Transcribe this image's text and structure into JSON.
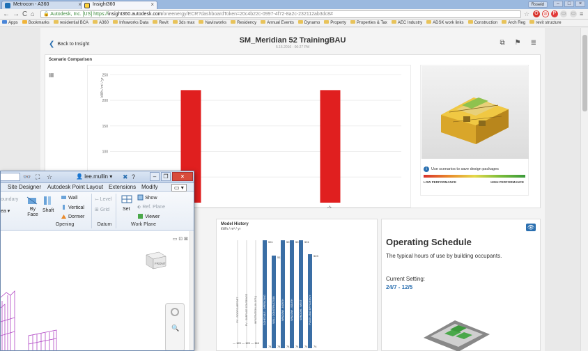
{
  "browser": {
    "tabs": [
      {
        "label": "Metrocon - A360",
        "icon": "a360-icon"
      },
      {
        "label": "Insight360",
        "icon": "insight-icon"
      }
    ],
    "user_chip": "Rsseid",
    "address": {
      "secure": "Autodesk, Inc. [US]",
      "scheme": "https://",
      "host": "insight360.autodesk.com",
      "path": "/oneenergy/ECR?dashboardToken=20c4b22c-0997-4f72-8a2c-232112ab3dc8#"
    },
    "bookmarks": [
      "Apps",
      "Bookmarks",
      "residential BCA",
      "A360",
      "Infraworks Data",
      "Revit",
      "3ds max",
      "Navisworks",
      "Residency",
      "Annual Events",
      "Dynamo",
      "Property",
      "Properties & Tax",
      "AEC Industry",
      "ADSK work links",
      "Construction",
      "Arch Reg",
      "revit structure"
    ]
  },
  "page": {
    "back_label": "Back to Insight",
    "title": "SM_Meridian 52 TrainingBAU",
    "date": "5.15.2016 - 06:27 PM"
  },
  "scenario_panel": {
    "title": "Scenario Comparison",
    "note": "Use scenarios to save design packages",
    "perf_low": "LOW PERFORMANCE",
    "perf_high": "HIGH PERFORMANCE"
  },
  "chart_data": {
    "type": "bar",
    "ylabel": "kWh / m² / yr",
    "yticks": [
      50,
      100,
      150,
      200,
      250
    ],
    "ylim": [
      0,
      260
    ],
    "categories": [
      "",
      "option 01"
    ],
    "values": [
      220,
      220
    ],
    "bar_color": "#e01f1f"
  },
  "model_history": {
    "title": "Model History",
    "unit": "kWh / m² / yr",
    "chart_data": {
      "type": "bar",
      "categories": [
        "PV - ROOF/CARPORT",
        "PV - SURFACE COVERAGE",
        "INFILTRATION (IN-SITU)",
        "SCHEDULE - OPERATING",
        "WALL CONSTRUCTION",
        "WINDOW - NORTH",
        "WINDOW - SOUTH",
        "WINDOW - WEST",
        "PLUG LOAD EFFICIENCY"
      ],
      "bar_tops": [
        "",
        "",
        "",
        "591",
        "513",
        "591",
        "591",
        "591",
        "523"
      ],
      "bottom_labels": [
        "120",
        "120",
        "116",
        "",
        "",
        "",
        "",
        "",
        ""
      ],
      "bar_bottoms": [
        "",
        "",
        "",
        "74",
        "74",
        "74",
        "74",
        "74",
        "74"
      ],
      "bar_color": "#3a6ea5"
    }
  },
  "operating_schedule": {
    "title": "Operating Schedule",
    "description": "The typical hours of use by building occupants.",
    "current_label": "Current Setting:",
    "current_value": "24/7 - 12/5"
  },
  "revit": {
    "user": "lee.mullin",
    "help": "?",
    "tabs": [
      "Site Designer",
      "Autodesk Point Layout",
      "Extensions",
      "Modify"
    ],
    "ribbon": {
      "boundary": "oundary",
      "area": "ea",
      "by_face": "By Face",
      "shaft": "Shaft",
      "wall": "Wall",
      "vertical": "Vertical",
      "dormer": "Dormer",
      "level": "Level",
      "grid": "Grid",
      "set": "Set",
      "show": "Show",
      "ref_plane": "Ref. Plane",
      "viewer": "Viewer"
    },
    "groups": [
      "Opening",
      "Datum",
      "Work Plane"
    ],
    "view_cube": "FRONT"
  }
}
